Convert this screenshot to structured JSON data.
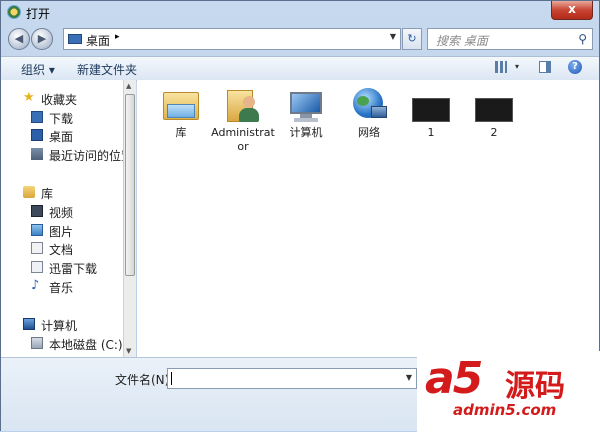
{
  "window": {
    "title": "打开",
    "close_label": "x"
  },
  "address": {
    "location": "桌面",
    "separator": "▸",
    "dropdown": "▼"
  },
  "nav": {
    "back": "◀",
    "forward": "▶",
    "refresh": "↻"
  },
  "search": {
    "placeholder": "搜索 桌面",
    "icon": "⚲"
  },
  "toolbar": {
    "organize": "组织 ▾",
    "new_folder": "新建文件夹",
    "views_arrow": "▾",
    "help": "?"
  },
  "sidebar": {
    "favorites": "收藏夹",
    "downloads": "下载",
    "desktop": "桌面",
    "recent": "最近访问的位置",
    "libraries": "库",
    "videos": "视频",
    "pictures": "图片",
    "documents": "文档",
    "thunder": "迅雷下载",
    "music": "音乐",
    "computer": "计算机",
    "local_disk": "本地磁盘 (C:)"
  },
  "scrollbar": {
    "up": "▲",
    "down": "▼"
  },
  "files": [
    {
      "label": "库",
      "icon": "library-folder-icon"
    },
    {
      "label": "Administrator",
      "icon": "user-folder-icon"
    },
    {
      "label": "计算机",
      "icon": "computer-icon"
    },
    {
      "label": "网络",
      "icon": "network-icon"
    },
    {
      "label": "1",
      "icon": "thumbnail-icon"
    },
    {
      "label": "2",
      "icon": "thumbnail-icon"
    }
  ],
  "filename": {
    "label": "文件名(N):",
    "value": "",
    "dropdown": "▼"
  },
  "watermark": {
    "logo": "a5",
    "cn": "源码",
    "url": "admin5.com"
  }
}
